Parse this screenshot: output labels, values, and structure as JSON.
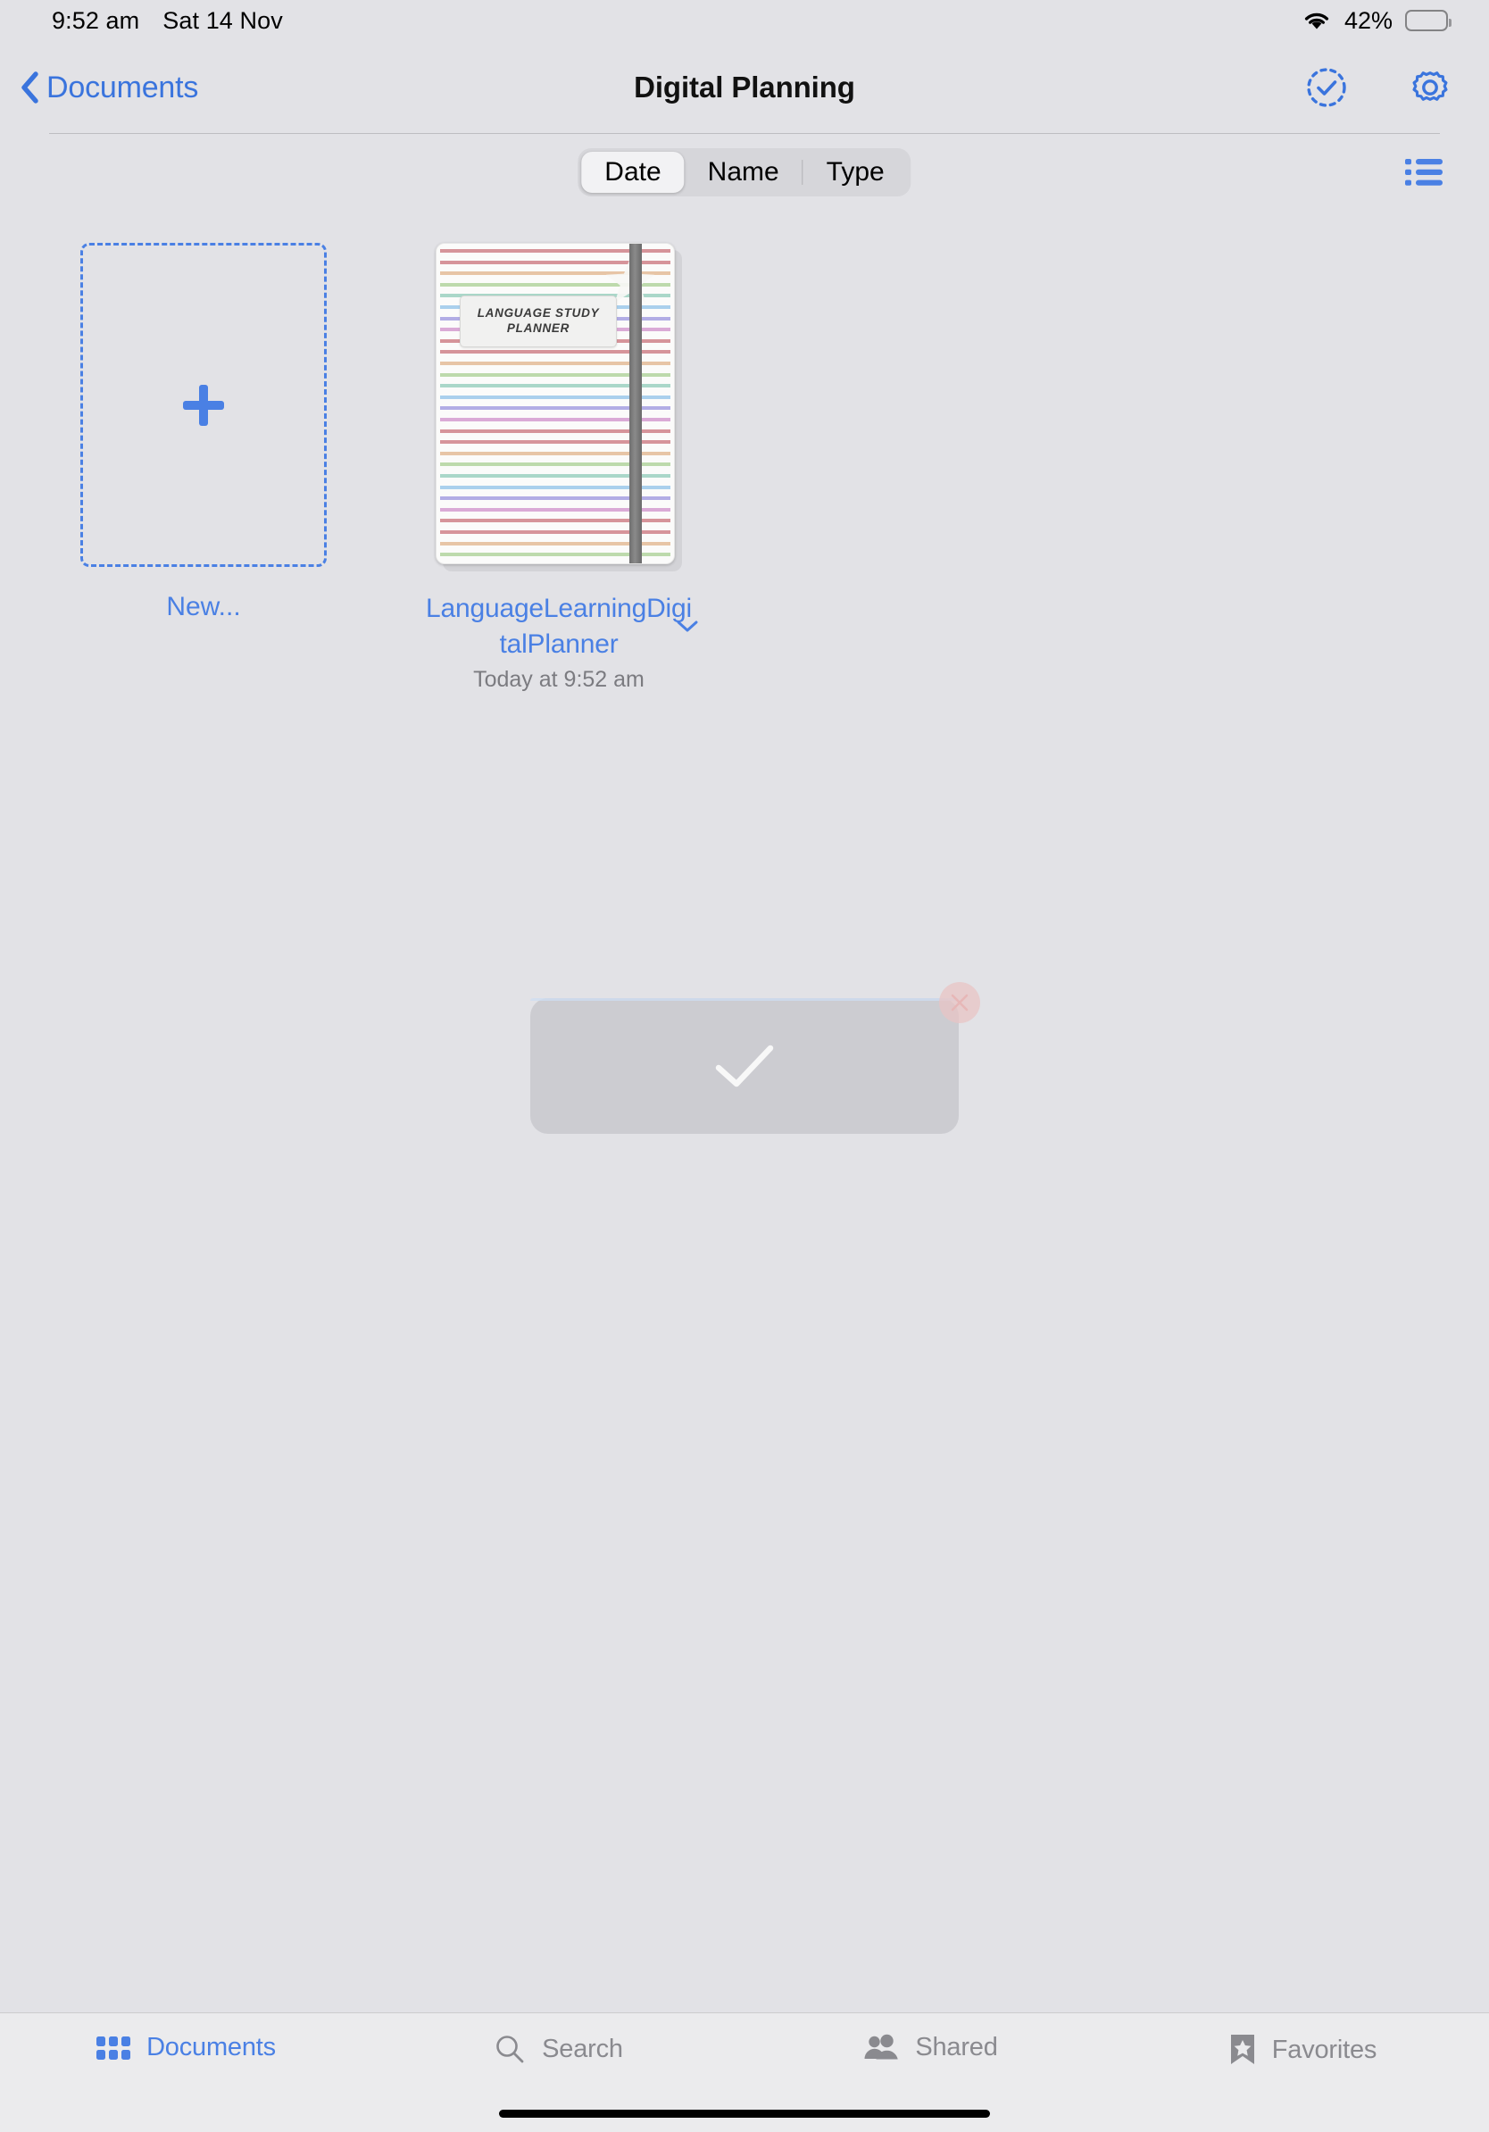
{
  "status_bar": {
    "time": "9:52 am",
    "date": "Sat 14 Nov",
    "battery_percent": "42%",
    "wifi_icon": "wifi-icon",
    "battery_icon": "battery-icon",
    "battery_level": 42
  },
  "nav": {
    "back_label": "Documents",
    "back_icon": "chevron-left-icon",
    "title": "Digital Planning",
    "select_icon": "check-circle-dashed-icon",
    "settings_icon": "gear-icon"
  },
  "toolbar": {
    "segments": [
      {
        "label": "Date",
        "selected": true
      },
      {
        "label": "Name",
        "selected": false
      },
      {
        "label": "Type",
        "selected": false
      }
    ],
    "list_view_icon": "list-view-icon"
  },
  "grid": {
    "new_tile": {
      "label": "New...",
      "icon": "plus-icon"
    },
    "documents": [
      {
        "name": "LanguageLearningDigitalPlanner",
        "date": "Today at 9:52 am",
        "menu_icon": "chevron-down-icon",
        "cover": {
          "title_line1": "LANGUAGE STUDY",
          "title_line2": "PLANNER",
          "sticker": "star-sticker-icon",
          "band": "elastic-band",
          "stripe_colors": [
            "#c9727a",
            "#c9727a",
            "#e0b389",
            "#a8cf92",
            "#8fcbb8",
            "#8fc2e8",
            "#9a93dd",
            "#cf8fc9"
          ]
        }
      }
    ]
  },
  "hud": {
    "icon": "checkmark-icon",
    "close_icon": "close-icon"
  },
  "tabs": [
    {
      "label": "Documents",
      "icon": "grid-icon",
      "active": true
    },
    {
      "label": "Search",
      "icon": "search-icon",
      "active": false
    },
    {
      "label": "Shared",
      "icon": "people-icon",
      "active": false
    },
    {
      "label": "Favorites",
      "icon": "bookmark-star-icon",
      "active": false
    }
  ],
  "colors": {
    "accent": "#4a80e4",
    "background": "#e2e2e6",
    "tabbar": "#ebebed",
    "inactive": "#8a8a8f"
  }
}
